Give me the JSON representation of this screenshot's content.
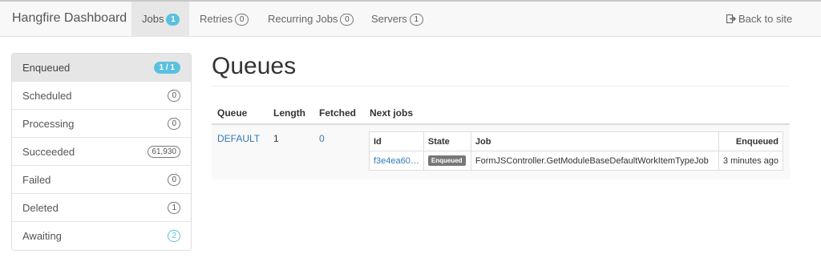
{
  "navbar": {
    "brand": "Hangfire Dashboard",
    "items": [
      {
        "label": "Jobs",
        "count": "1"
      },
      {
        "label": "Retries",
        "count": "0"
      },
      {
        "label": "Recurring Jobs",
        "count": "0"
      },
      {
        "label": "Servers",
        "count": "1"
      }
    ],
    "back_label": "Back to site"
  },
  "sidebar": {
    "items": [
      {
        "label": "Enqueued",
        "count": "1 / 1"
      },
      {
        "label": "Scheduled",
        "count": "0"
      },
      {
        "label": "Processing",
        "count": "0"
      },
      {
        "label": "Succeeded",
        "count": "61,930"
      },
      {
        "label": "Failed",
        "count": "0"
      },
      {
        "label": "Deleted",
        "count": "1"
      },
      {
        "label": "Awaiting",
        "count": "2"
      }
    ]
  },
  "main": {
    "title": "Queues",
    "columns": [
      "Queue",
      "Length",
      "Fetched",
      "Next jobs"
    ],
    "rows": [
      {
        "queue": "DEFAULT",
        "length": "1",
        "fetched": "0",
        "next_jobs": {
          "columns": [
            "Id",
            "State",
            "Job",
            "Enqueued"
          ],
          "rows": [
            {
              "id": "f3e4ea60…",
              "state": "Enqueued",
              "job": "FormJSController.GetModuleBaseDefaultWorkItemTypeJob",
              "enqueued": "3 minutes ago"
            }
          ]
        }
      }
    ]
  },
  "colors": {
    "accent": "#5bc0de",
    "link": "#337ab7",
    "state_enqueued": "#777777"
  }
}
